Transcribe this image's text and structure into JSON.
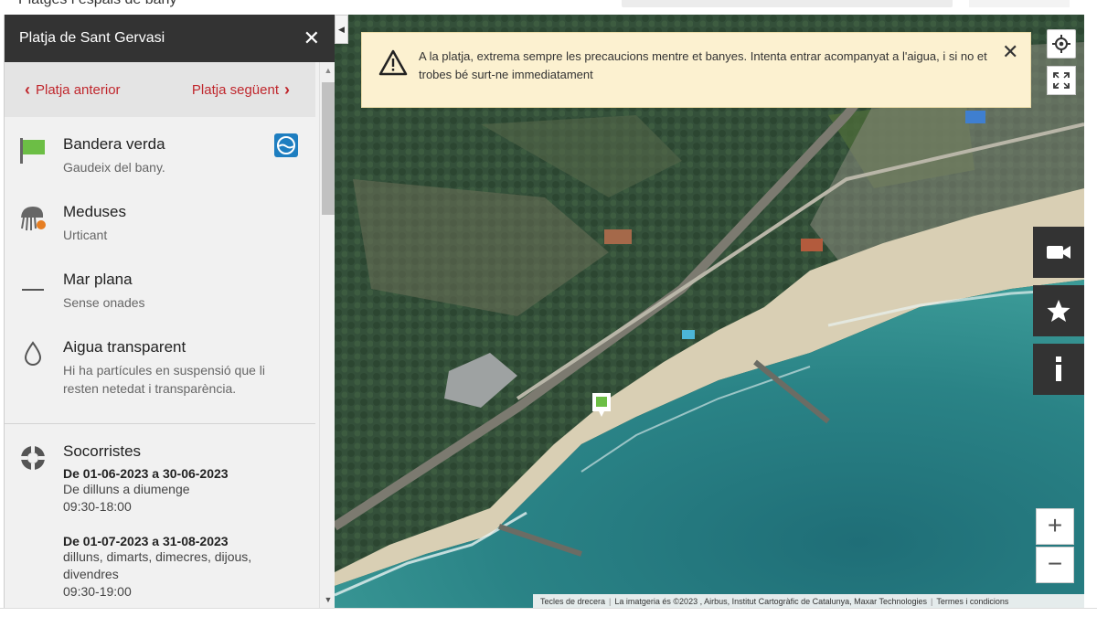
{
  "topbar": {
    "breadcrumb": "Platges i espais de bany"
  },
  "panel": {
    "title": "Platja de Sant Gervasi",
    "prev_label": "Platja anterior",
    "next_label": "Platja següent",
    "items": [
      {
        "title": "Bandera verda",
        "subtitle": "Gaudeix del bany.",
        "icon": "green-flag-icon"
      },
      {
        "title": "Meduses",
        "subtitle": "Urticant",
        "icon": "jellyfish-icon"
      },
      {
        "title": "Mar plana",
        "subtitle": "Sense onades",
        "icon": "flat-sea-icon"
      },
      {
        "title": "Aigua transparent",
        "subtitle": "Hi ha partícules en suspensió que li resten netedat i transparència.",
        "icon": "water-drop-icon"
      }
    ],
    "lifeguards": {
      "title": "Socorristes",
      "schedules": [
        {
          "dates": "De 01-06-2023 a 30-06-2023",
          "days": "De dilluns a diumenge",
          "hours": "09:30-18:00"
        },
        {
          "dates": "De 01-07-2023 a 31-08-2023",
          "days": "dilluns, dimarts, dimecres, dijous, divendres",
          "hours": "09:30-19:00"
        }
      ]
    }
  },
  "alert": {
    "message": "A la platja, extrema sempre les precaucions mentre et banyes. Intenta entrar acompanyat a l'aigua, i si no et trobes bé surt-ne immediatament"
  },
  "map": {
    "attribution": [
      "Tecles de drecera",
      "La imatgeria és ©2023 , Airbus, Institut Cartogràfic de Catalunya, Maxar Technologies",
      "Termes i condicions"
    ],
    "zoom_in": "+",
    "zoom_out": "−",
    "colors": {
      "accent": "#c0272d",
      "flag": "#6cbe45",
      "dark": "#333333",
      "alert_bg": "#fcf1d0"
    }
  }
}
